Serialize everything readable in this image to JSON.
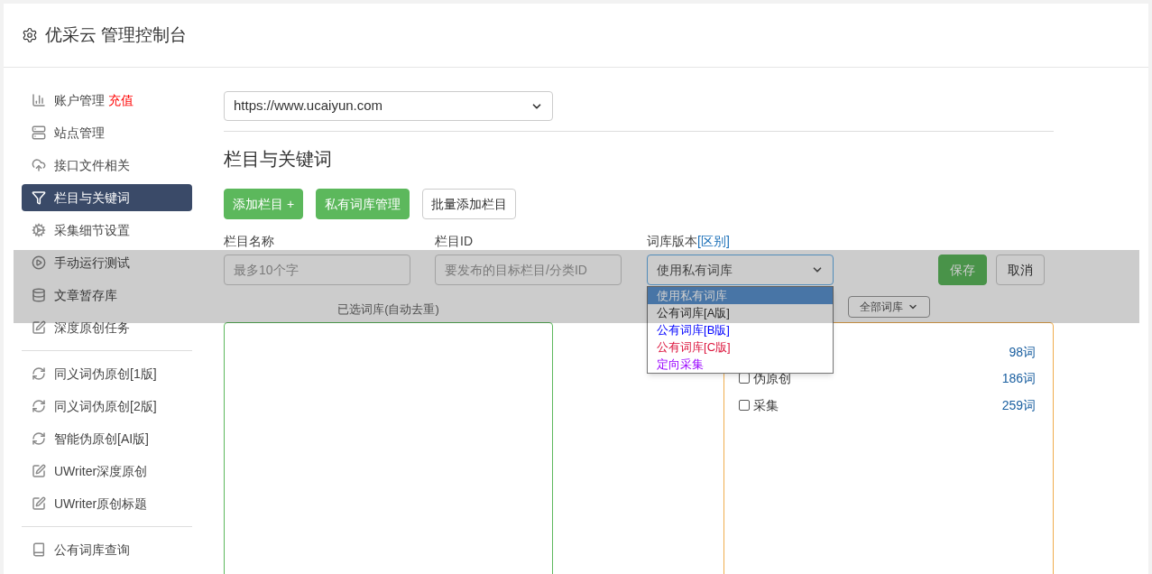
{
  "header": {
    "title": "优采云 管理控制台"
  },
  "sidebar": {
    "groups": [
      [
        {
          "label": "账户管理",
          "badge": "充值",
          "selected": false
        },
        {
          "label": "站点管理",
          "selected": false
        },
        {
          "label": "接口文件相关",
          "selected": false
        },
        {
          "label": "栏目与关键词",
          "selected": true
        },
        {
          "label": "采集细节设置",
          "selected": false
        },
        {
          "label": "手动运行测试",
          "selected": false
        },
        {
          "label": "文章暂存库",
          "selected": false
        },
        {
          "label": "深度原创任务",
          "selected": false
        }
      ],
      [
        {
          "label": "同义词伪原创[1版]",
          "selected": false
        },
        {
          "label": "同义词伪原创[2版]",
          "selected": false
        },
        {
          "label": "智能伪原创[AI版]",
          "selected": false
        },
        {
          "label": "UWriter深度原创",
          "selected": false
        },
        {
          "label": "UWriter原创标题",
          "selected": false
        }
      ],
      [
        {
          "label": "公有词库查询",
          "selected": false
        }
      ]
    ]
  },
  "site_select": {
    "value": "https://www.ucaiyun.com"
  },
  "heading": "栏目与关键词",
  "toolbar": [
    {
      "label": "添加栏目 +",
      "kind": "primary"
    },
    {
      "label": "私有词库管理",
      "kind": "primary"
    },
    {
      "label": "批量添加栏目",
      "kind": "outline"
    }
  ],
  "form": {
    "name_field": {
      "label": "栏目名称",
      "placeholder": "最多10个字"
    },
    "id_field": {
      "label": "栏目ID",
      "placeholder": "要发布的目标栏目/分类ID"
    },
    "version_select": {
      "label": "词库版本",
      "link": "[区别]",
      "value": "使用私有词库",
      "expanded": true,
      "options": [
        {
          "label": "使用私有词库",
          "selected": true
        },
        {
          "label": "公有词库[A版]",
          "selected": false,
          "color": "#333333"
        },
        {
          "label": "公有词库[B版]",
          "selected": false,
          "color": "#0000ff"
        },
        {
          "label": "公有词库[C版]",
          "selected": false,
          "color": "#dc143c"
        },
        {
          "label": "定向采集",
          "selected": false,
          "color": "#9900ff"
        }
      ]
    },
    "actions": [
      {
        "label": "保存",
        "kind": "primary"
      },
      {
        "label": "取消",
        "kind": "outline"
      }
    ]
  },
  "selected_panel": {
    "title": "已选词库(自动去重)"
  },
  "library_filter": {
    "value": "全部词库"
  },
  "library_list": [
    {
      "count": "98词"
    },
    {
      "label": "伪原创",
      "checked": false,
      "count": "186词"
    },
    {
      "label": "采集",
      "checked": false,
      "count": "259词"
    }
  ]
}
